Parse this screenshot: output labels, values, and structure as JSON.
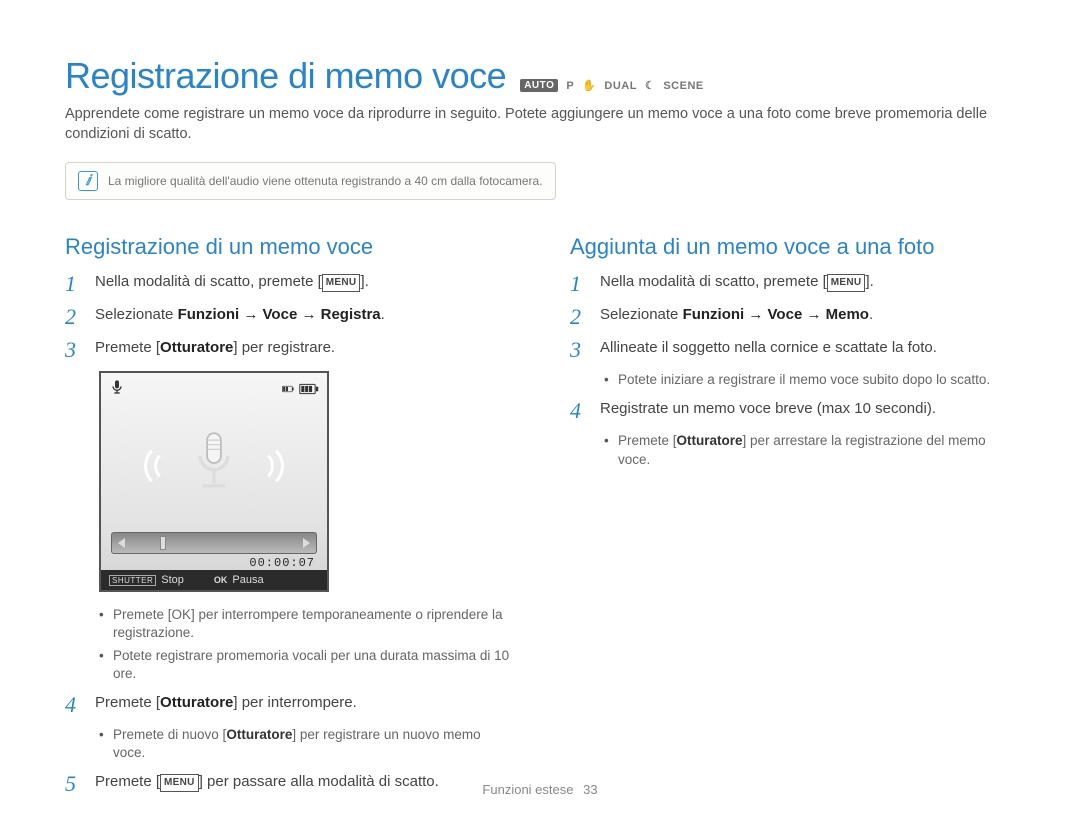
{
  "title": "Registrazione di memo voce",
  "modes": {
    "auto_badge": "AUTO",
    "p": "P",
    "dual": "DUAL",
    "scene": "SCENE"
  },
  "intro": "Apprendete come registrare un memo voce da riprodurre in seguito. Potete aggiungere un memo voce a una foto come breve promemoria delle condizioni di scatto.",
  "note": "La migliore qualità dell'audio viene ottenuta registrando a 40 cm dalla fotocamera.",
  "left": {
    "heading": "Registrazione di un memo voce",
    "step1_a": "Nella modalità di scatto, premete [",
    "step1_btn": "MENU",
    "step1_b": "].",
    "step2_a": "Selezionate ",
    "step2_b": "Funzioni → Voce → Registra",
    "step2_c": ".",
    "step3_a": "Premete [",
    "step3_bold": "Otturatore",
    "step3_b": "] per registrare.",
    "screen": {
      "time": "00:00:07",
      "shutter_label": "SHUTTER",
      "stop": "Stop",
      "ok_label": "OK",
      "pause": "Pausa"
    },
    "bullet3a_a": "Premete [",
    "bullet3a_btn": "OK",
    "bullet3a_b": "] per interrompere temporaneamente o riprendere la registrazione.",
    "bullet3b": "Potete registrare promemoria vocali per una durata massima di 10 ore.",
    "step4_a": "Premete [",
    "step4_bold": "Otturatore",
    "step4_b": "] per interrompere.",
    "bullet4_a": "Premete di nuovo [",
    "bullet4_bold": "Otturatore",
    "bullet4_b": "] per registrare un nuovo memo voce.",
    "step5_a": "Premete [",
    "step5_btn": "MENU",
    "step5_b": "] per passare alla modalità di scatto."
  },
  "right": {
    "heading": "Aggiunta di un memo voce a una foto",
    "step1_a": "Nella modalità di scatto, premete [",
    "step1_btn": "MENU",
    "step1_b": "].",
    "step2_a": "Selezionate ",
    "step2_b": "Funzioni → Voce → Memo",
    "step2_c": ".",
    "step3": "Allineate il soggetto nella cornice e scattate la foto.",
    "bullet3": "Potete iniziare a registrare il memo voce subito dopo lo scatto.",
    "step4": "Registrate un memo voce breve (max 10 secondi).",
    "bullet4_a": "Premete [",
    "bullet4_bold": "Otturatore",
    "bullet4_b": "] per arrestare la registrazione del memo voce."
  },
  "footer": {
    "section": "Funzioni estese",
    "page": "33"
  }
}
